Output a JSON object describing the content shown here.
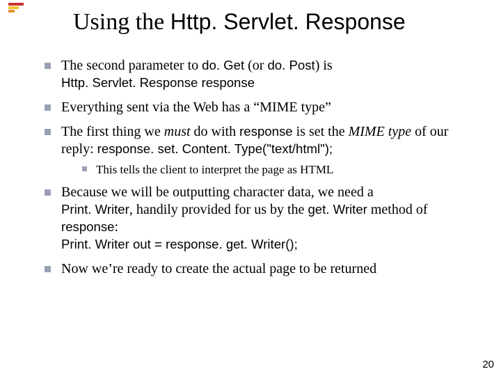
{
  "title": {
    "prefix": "Using the ",
    "code": "Http. Servlet. Response"
  },
  "bullets": [
    {
      "segments": [
        {
          "t": "The second parameter to "
        },
        {
          "t": "do. Get",
          "cls": "sans"
        },
        {
          "t": " (or "
        },
        {
          "t": "do. Post",
          "cls": "sans"
        },
        {
          "t": ") is "
        },
        {
          "br": true
        },
        {
          "t": "Http. Servlet. Response response",
          "cls": "sans"
        }
      ]
    },
    {
      "segments": [
        {
          "t": "Everything sent via the Web has a “MIME type”"
        }
      ]
    },
    {
      "segments": [
        {
          "t": "The first thing we "
        },
        {
          "t": "must",
          "cls": "ital"
        },
        {
          "t": " do with "
        },
        {
          "t": "response",
          "cls": "sans"
        },
        {
          "t": " is set the "
        },
        {
          "t": "MIME type",
          "cls": "ital"
        },
        {
          "t": " of our reply: "
        },
        {
          "t": "response. set. Content. Type(\"text/html\");",
          "cls": "sans"
        }
      ],
      "sub": [
        {
          "segments": [
            {
              "t": "This tells the client to interpret the page as HTML"
            }
          ]
        }
      ]
    },
    {
      "segments": [
        {
          "t": "Because we will be outputting character data, we need a "
        },
        {
          "br": true
        },
        {
          "t": "Print. Writer",
          "cls": "sans"
        },
        {
          "t": ", handily provided for us by the "
        },
        {
          "t": "get. Writer",
          "cls": "sans"
        },
        {
          "t": " method of "
        },
        {
          "t": "response",
          "cls": "sans"
        },
        {
          "t": ":"
        },
        {
          "br": true
        },
        {
          "t": "Print. Writer out = response. get. Writer();",
          "cls": "sans"
        }
      ]
    },
    {
      "segments": [
        {
          "t": "Now we’re ready to create the actual page to be returned"
        }
      ]
    }
  ],
  "page_number": "20"
}
